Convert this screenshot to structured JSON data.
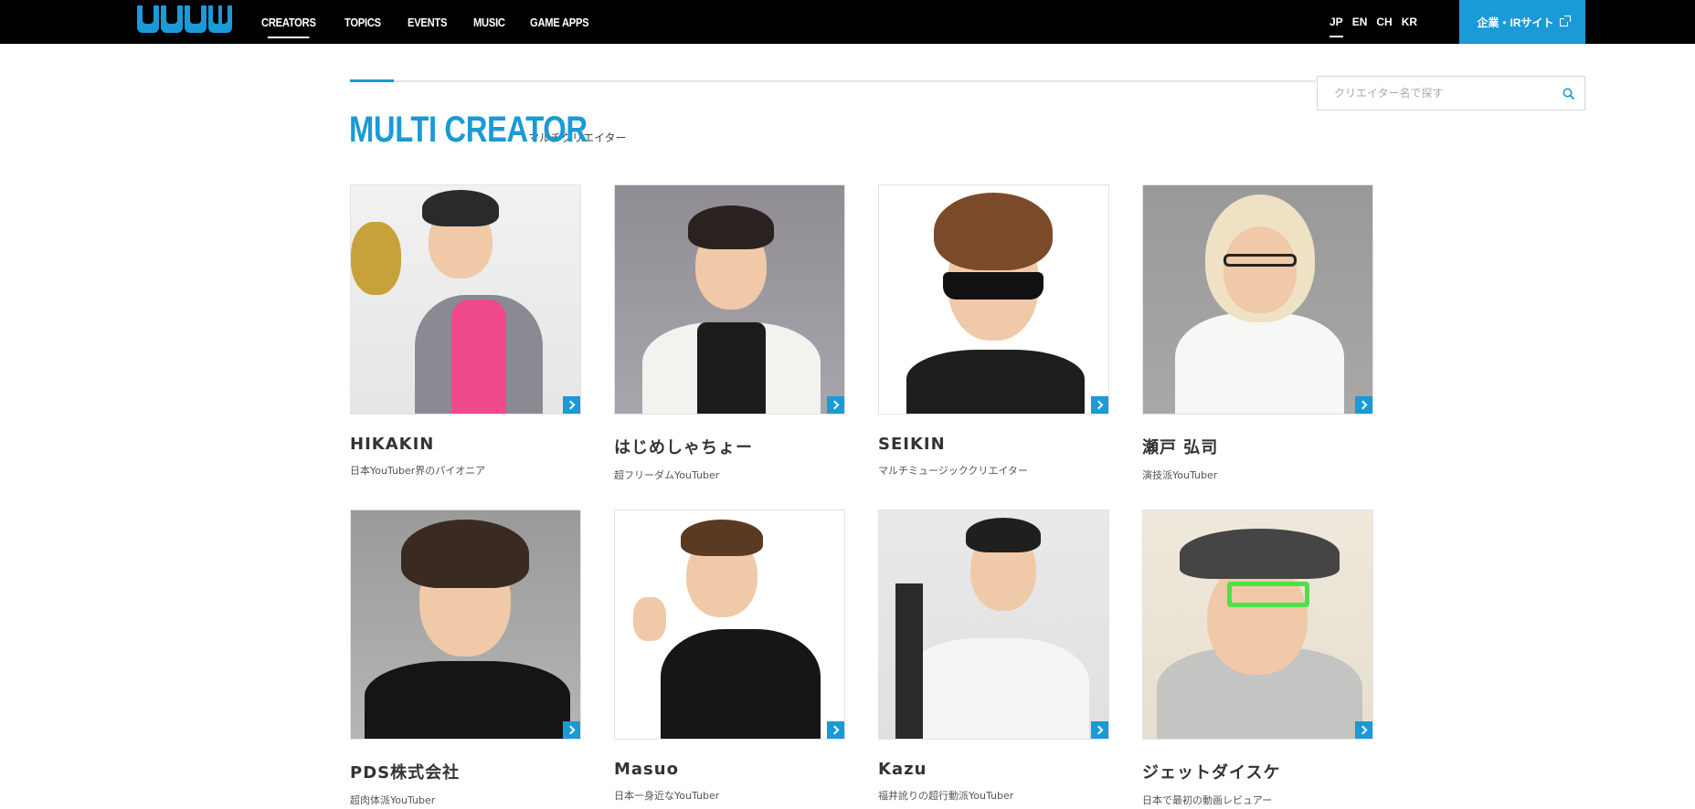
{
  "header": {
    "logo_text": "UUUM",
    "nav": [
      {
        "label": "CREATORS",
        "active": true
      },
      {
        "label": "TOPICS",
        "active": false
      },
      {
        "label": "EVENTS",
        "active": false
      },
      {
        "label": "MUSIC",
        "active": false
      },
      {
        "label": "GAME APPS",
        "active": false
      }
    ],
    "languages": [
      {
        "label": "JP",
        "active": true
      },
      {
        "label": "EN",
        "active": false
      },
      {
        "label": "CH",
        "active": false
      },
      {
        "label": "KR",
        "active": false
      }
    ],
    "ir_button": "企業・IRサイト"
  },
  "search": {
    "placeholder": "クリエイター名で探す"
  },
  "section": {
    "title": "MULTI CREATOR",
    "subtitle": "マルチクリエイター"
  },
  "creators": [
    {
      "name": "HIKAKIN",
      "desc": "日本YouTuber界のパイオニア"
    },
    {
      "name": "はじめしゃちょー",
      "desc": "超フリーダムYouTuber"
    },
    {
      "name": "SEIKIN",
      "desc": "マルチミュージッククリエイター"
    },
    {
      "name": "瀬戸 弘司",
      "desc": "演技派YouTuber"
    },
    {
      "name": "PDS株式会社",
      "desc": "超肉体派YouTuber"
    },
    {
      "name": "Masuo",
      "desc": "日本一身近なYouTuber"
    },
    {
      "name": "Kazu",
      "desc": "福井訛りの超行動派YouTuber"
    },
    {
      "name": "ジェットダイスケ",
      "desc": "日本で最初の動画レビュアー"
    }
  ],
  "colors": {
    "accent": "#1a9ad6",
    "header_bg": "#000000"
  }
}
